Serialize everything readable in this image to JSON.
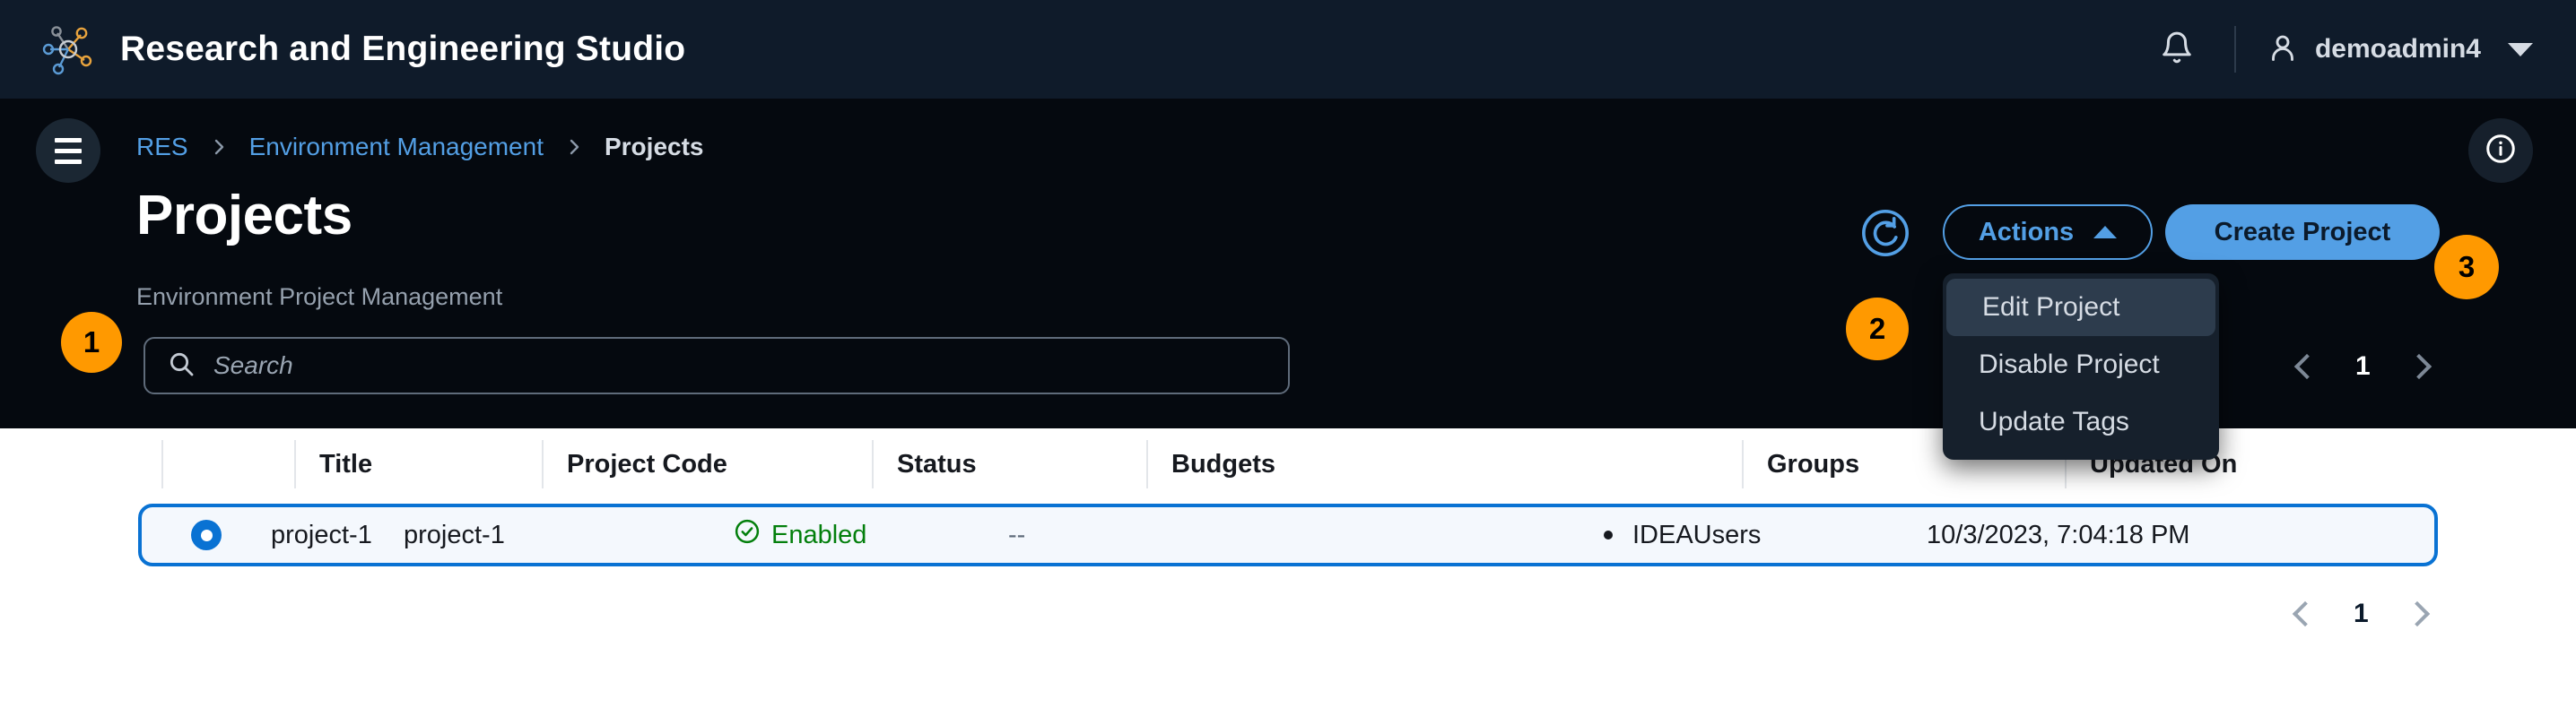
{
  "app": {
    "title": "Research and Engineering Studio",
    "logo_icon": "molecule-network-icon"
  },
  "topnav": {
    "notifications_icon": "bell-icon",
    "user_icon": "person-icon",
    "username": "demoadmin4",
    "user_caret_icon": "chevron-down-icon"
  },
  "breadcrumb": {
    "menu_icon": "hamburger-menu-icon",
    "items": [
      {
        "label": "RES",
        "current": false
      },
      {
        "label": "Environment Management",
        "current": false
      },
      {
        "label": "Projects",
        "current": true
      }
    ],
    "separator": "›",
    "info_icon": "info-circle-icon"
  },
  "header": {
    "title": "Projects",
    "subtitle": "Environment Project Management"
  },
  "search": {
    "icon": "search-icon",
    "placeholder": "Search",
    "value": ""
  },
  "toolbar": {
    "refresh_icon": "refresh-icon",
    "actions_label": "Actions",
    "actions_caret_icon": "chevron-up-icon",
    "create_label": "Create Project"
  },
  "dropdown": {
    "items": [
      {
        "label": "Edit Project",
        "active": true
      },
      {
        "label": "Disable Project",
        "active": false
      },
      {
        "label": "Update Tags",
        "active": false
      }
    ]
  },
  "callouts": [
    {
      "number": "1"
    },
    {
      "number": "2"
    },
    {
      "number": "3"
    }
  ],
  "pagination": {
    "prev_icon": "chevron-left-icon",
    "next_icon": "chevron-right-icon",
    "page": "1"
  },
  "table": {
    "columns": [
      "Title",
      "Project Code",
      "Status",
      "Budgets",
      "Groups",
      "Updated On"
    ],
    "rows": [
      {
        "selected": true,
        "title": "project-1",
        "project_code": "project-1",
        "status": "Enabled",
        "status_icon": "check-circle-icon",
        "budgets": "--",
        "groups": [
          "IDEAUsers"
        ],
        "updated_on": "10/3/2023, 7:04:18 PM"
      }
    ]
  },
  "colors": {
    "topnav_bg": "#0f1b2a",
    "dark_bg": "#05090f",
    "accent_blue": "#539fe5",
    "link_blue": "#539fe5",
    "select_blue": "#0972d3",
    "badge_orange": "#ff9900",
    "status_green": "#037f0c",
    "row_bg": "#f4f8fd"
  }
}
